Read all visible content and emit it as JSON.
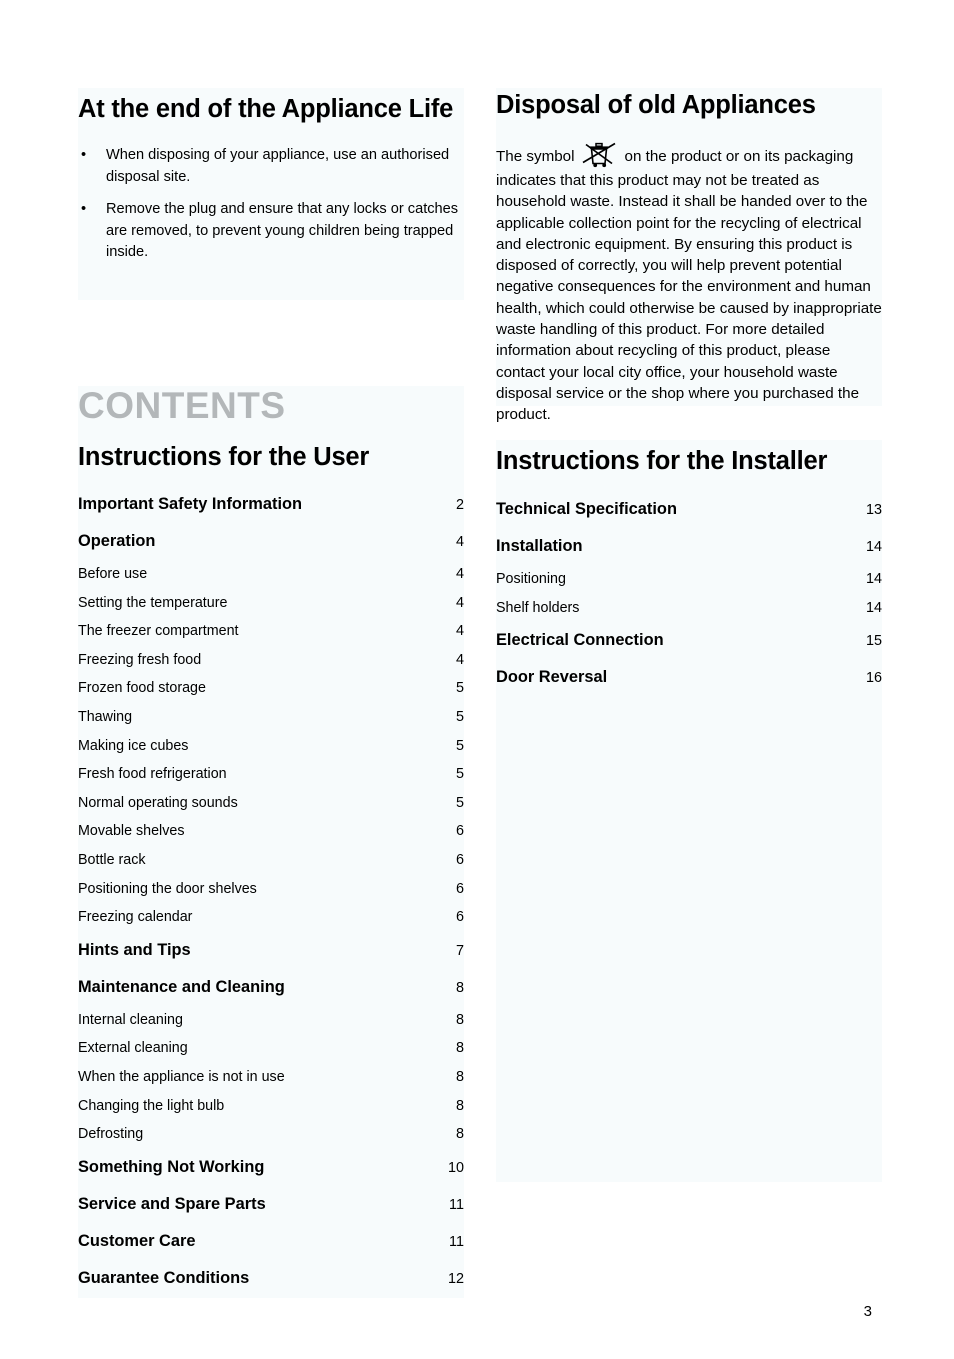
{
  "page": {
    "number": "3",
    "accent_gray": "#b3b7b9",
    "tint": "#f7fbfc"
  },
  "left_column": {
    "appliance_life": {
      "title": "At the end of the Appliance Life",
      "bullet_glyph": "•",
      "bullets": [
        "When disposing of your appliance, use an authorised disposal site.",
        "Remove the plug and ensure that any locks or catches are removed, to prevent young children being trapped inside."
      ]
    },
    "contents_heading": "CONTENTS",
    "user_group_title": "Instructions for the User",
    "toc": [
      {
        "label": "Important Safety Information",
        "page": "2",
        "level": "major"
      },
      {
        "label": "Operation",
        "page": "4",
        "level": "major"
      },
      {
        "label": "Before use",
        "page": "4",
        "level": "minor"
      },
      {
        "label": "Setting the temperature",
        "page": "4",
        "level": "minor"
      },
      {
        "label": "The freezer compartment",
        "page": "4",
        "level": "minor"
      },
      {
        "label": "Freezing fresh food",
        "page": "4",
        "level": "minor"
      },
      {
        "label": "Frozen food storage",
        "page": "5",
        "level": "minor"
      },
      {
        "label": "Thawing",
        "page": "5",
        "level": "minor"
      },
      {
        "label": "Making ice cubes",
        "page": "5",
        "level": "minor"
      },
      {
        "label": "Fresh food refrigeration",
        "page": "5",
        "level": "minor"
      },
      {
        "label": "Normal operating sounds",
        "page": "5",
        "level": "minor"
      },
      {
        "label": "Movable shelves",
        "page": "6",
        "level": "minor"
      },
      {
        "label": "Bottle rack",
        "page": "6",
        "level": "minor"
      },
      {
        "label": "Positioning the door shelves",
        "page": "6",
        "level": "minor"
      },
      {
        "label": "Freezing calendar",
        "page": "6",
        "level": "minor"
      },
      {
        "label": "Hints and Tips",
        "page": "7",
        "level": "major"
      },
      {
        "label": "Maintenance and Cleaning",
        "page": "8",
        "level": "major"
      },
      {
        "label": "Internal cleaning",
        "page": "8",
        "level": "minor"
      },
      {
        "label": "External cleaning",
        "page": "8",
        "level": "minor"
      },
      {
        "label": "When the appliance is not in use",
        "page": "8",
        "level": "minor"
      },
      {
        "label": "Changing the light bulb",
        "page": "8",
        "level": "minor"
      },
      {
        "label": "Defrosting",
        "page": "8",
        "level": "minor"
      },
      {
        "label": "Something Not Working",
        "page": "10",
        "level": "major"
      },
      {
        "label": "Service and Spare Parts",
        "page": "11",
        "level": "major"
      },
      {
        "label": "Customer Care",
        "page": "11",
        "level": "major"
      },
      {
        "label": "Guarantee Conditions",
        "page": "12",
        "level": "major"
      }
    ]
  },
  "right_column": {
    "disposal": {
      "title": "Disposal of old Appliances",
      "icon_name": "crossed-out-wheelie-bin-icon",
      "text_before_icon": "The symbol",
      "text_after_icon": "on the product or on its packaging indicates that this product may not be treated as household waste. Instead it shall be handed over to the applicable collection point for the recycling of electrical and electronic equipment. By ensuring this product is disposed of correctly, you will help prevent potential negative consequences for the environment and human health, which could otherwise be caused by inappropriate waste handling of this product. For more detailed information about recycling of this product, please contact your local city office, your household waste disposal service or the shop where you purchased the product."
    },
    "installer_group_title": "Instructions for the Installer",
    "toc": [
      {
        "label": "Technical Specification",
        "page": "13",
        "level": "major"
      },
      {
        "label": "Installation",
        "page": "14",
        "level": "major"
      },
      {
        "label": "Positioning",
        "page": "14",
        "level": "minor"
      },
      {
        "label": "Shelf holders",
        "page": "14",
        "level": "minor"
      },
      {
        "label": "Electrical Connection",
        "page": "15",
        "level": "major"
      },
      {
        "label": "Door Reversal",
        "page": "16",
        "level": "major"
      }
    ]
  }
}
